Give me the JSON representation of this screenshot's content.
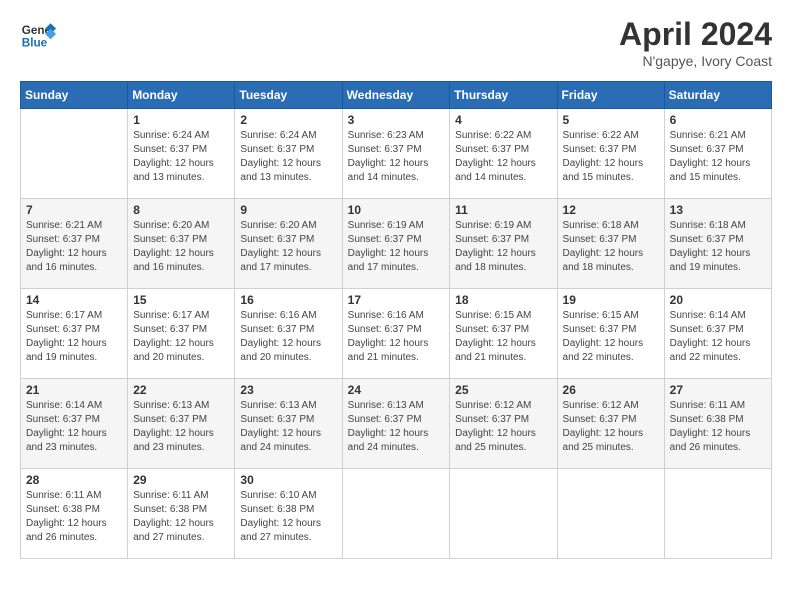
{
  "header": {
    "logo_line1": "General",
    "logo_line2": "Blue",
    "month_title": "April 2024",
    "location": "N'gapye, Ivory Coast"
  },
  "weekdays": [
    "Sunday",
    "Monday",
    "Tuesday",
    "Wednesday",
    "Thursday",
    "Friday",
    "Saturday"
  ],
  "weeks": [
    [
      {
        "day": "",
        "sunrise": "",
        "sunset": "",
        "daylight": ""
      },
      {
        "day": "1",
        "sunrise": "Sunrise: 6:24 AM",
        "sunset": "Sunset: 6:37 PM",
        "daylight": "Daylight: 12 hours and 13 minutes."
      },
      {
        "day": "2",
        "sunrise": "Sunrise: 6:24 AM",
        "sunset": "Sunset: 6:37 PM",
        "daylight": "Daylight: 12 hours and 13 minutes."
      },
      {
        "day": "3",
        "sunrise": "Sunrise: 6:23 AM",
        "sunset": "Sunset: 6:37 PM",
        "daylight": "Daylight: 12 hours and 14 minutes."
      },
      {
        "day": "4",
        "sunrise": "Sunrise: 6:22 AM",
        "sunset": "Sunset: 6:37 PM",
        "daylight": "Daylight: 12 hours and 14 minutes."
      },
      {
        "day": "5",
        "sunrise": "Sunrise: 6:22 AM",
        "sunset": "Sunset: 6:37 PM",
        "daylight": "Daylight: 12 hours and 15 minutes."
      },
      {
        "day": "6",
        "sunrise": "Sunrise: 6:21 AM",
        "sunset": "Sunset: 6:37 PM",
        "daylight": "Daylight: 12 hours and 15 minutes."
      }
    ],
    [
      {
        "day": "7",
        "sunrise": "Sunrise: 6:21 AM",
        "sunset": "Sunset: 6:37 PM",
        "daylight": "Daylight: 12 hours and 16 minutes."
      },
      {
        "day": "8",
        "sunrise": "Sunrise: 6:20 AM",
        "sunset": "Sunset: 6:37 PM",
        "daylight": "Daylight: 12 hours and 16 minutes."
      },
      {
        "day": "9",
        "sunrise": "Sunrise: 6:20 AM",
        "sunset": "Sunset: 6:37 PM",
        "daylight": "Daylight: 12 hours and 17 minutes."
      },
      {
        "day": "10",
        "sunrise": "Sunrise: 6:19 AM",
        "sunset": "Sunset: 6:37 PM",
        "daylight": "Daylight: 12 hours and 17 minutes."
      },
      {
        "day": "11",
        "sunrise": "Sunrise: 6:19 AM",
        "sunset": "Sunset: 6:37 PM",
        "daylight": "Daylight: 12 hours and 18 minutes."
      },
      {
        "day": "12",
        "sunrise": "Sunrise: 6:18 AM",
        "sunset": "Sunset: 6:37 PM",
        "daylight": "Daylight: 12 hours and 18 minutes."
      },
      {
        "day": "13",
        "sunrise": "Sunrise: 6:18 AM",
        "sunset": "Sunset: 6:37 PM",
        "daylight": "Daylight: 12 hours and 19 minutes."
      }
    ],
    [
      {
        "day": "14",
        "sunrise": "Sunrise: 6:17 AM",
        "sunset": "Sunset: 6:37 PM",
        "daylight": "Daylight: 12 hours and 19 minutes."
      },
      {
        "day": "15",
        "sunrise": "Sunrise: 6:17 AM",
        "sunset": "Sunset: 6:37 PM",
        "daylight": "Daylight: 12 hours and 20 minutes."
      },
      {
        "day": "16",
        "sunrise": "Sunrise: 6:16 AM",
        "sunset": "Sunset: 6:37 PM",
        "daylight": "Daylight: 12 hours and 20 minutes."
      },
      {
        "day": "17",
        "sunrise": "Sunrise: 6:16 AM",
        "sunset": "Sunset: 6:37 PM",
        "daylight": "Daylight: 12 hours and 21 minutes."
      },
      {
        "day": "18",
        "sunrise": "Sunrise: 6:15 AM",
        "sunset": "Sunset: 6:37 PM",
        "daylight": "Daylight: 12 hours and 21 minutes."
      },
      {
        "day": "19",
        "sunrise": "Sunrise: 6:15 AM",
        "sunset": "Sunset: 6:37 PM",
        "daylight": "Daylight: 12 hours and 22 minutes."
      },
      {
        "day": "20",
        "sunrise": "Sunrise: 6:14 AM",
        "sunset": "Sunset: 6:37 PM",
        "daylight": "Daylight: 12 hours and 22 minutes."
      }
    ],
    [
      {
        "day": "21",
        "sunrise": "Sunrise: 6:14 AM",
        "sunset": "Sunset: 6:37 PM",
        "daylight": "Daylight: 12 hours and 23 minutes."
      },
      {
        "day": "22",
        "sunrise": "Sunrise: 6:13 AM",
        "sunset": "Sunset: 6:37 PM",
        "daylight": "Daylight: 12 hours and 23 minutes."
      },
      {
        "day": "23",
        "sunrise": "Sunrise: 6:13 AM",
        "sunset": "Sunset: 6:37 PM",
        "daylight": "Daylight: 12 hours and 24 minutes."
      },
      {
        "day": "24",
        "sunrise": "Sunrise: 6:13 AM",
        "sunset": "Sunset: 6:37 PM",
        "daylight": "Daylight: 12 hours and 24 minutes."
      },
      {
        "day": "25",
        "sunrise": "Sunrise: 6:12 AM",
        "sunset": "Sunset: 6:37 PM",
        "daylight": "Daylight: 12 hours and 25 minutes."
      },
      {
        "day": "26",
        "sunrise": "Sunrise: 6:12 AM",
        "sunset": "Sunset: 6:37 PM",
        "daylight": "Daylight: 12 hours and 25 minutes."
      },
      {
        "day": "27",
        "sunrise": "Sunrise: 6:11 AM",
        "sunset": "Sunset: 6:38 PM",
        "daylight": "Daylight: 12 hours and 26 minutes."
      }
    ],
    [
      {
        "day": "28",
        "sunrise": "Sunrise: 6:11 AM",
        "sunset": "Sunset: 6:38 PM",
        "daylight": "Daylight: 12 hours and 26 minutes."
      },
      {
        "day": "29",
        "sunrise": "Sunrise: 6:11 AM",
        "sunset": "Sunset: 6:38 PM",
        "daylight": "Daylight: 12 hours and 27 minutes."
      },
      {
        "day": "30",
        "sunrise": "Sunrise: 6:10 AM",
        "sunset": "Sunset: 6:38 PM",
        "daylight": "Daylight: 12 hours and 27 minutes."
      },
      {
        "day": "",
        "sunrise": "",
        "sunset": "",
        "daylight": ""
      },
      {
        "day": "",
        "sunrise": "",
        "sunset": "",
        "daylight": ""
      },
      {
        "day": "",
        "sunrise": "",
        "sunset": "",
        "daylight": ""
      },
      {
        "day": "",
        "sunrise": "",
        "sunset": "",
        "daylight": ""
      }
    ]
  ]
}
